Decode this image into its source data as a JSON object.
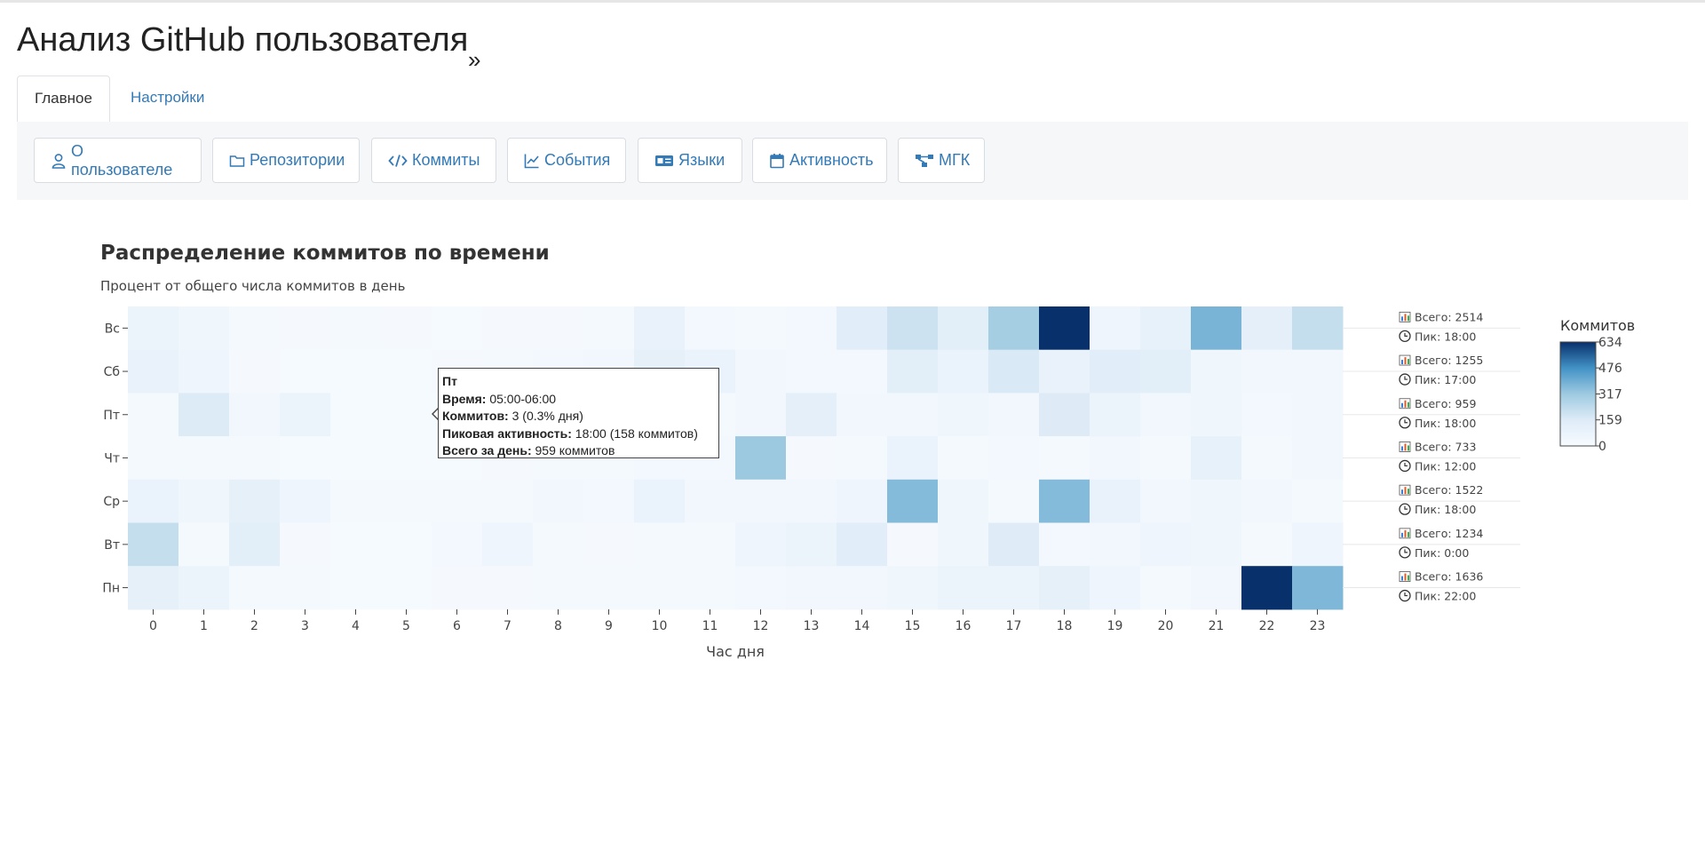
{
  "app": {
    "title": "Анализ GitHub пользователя",
    "title_glyph": "»"
  },
  "tabs": [
    {
      "label": "Главное",
      "active": true
    },
    {
      "label": "Настройки",
      "active": false
    }
  ],
  "toolbar": {
    "buttons": [
      {
        "label": "О пользователе",
        "icon": "user-icon"
      },
      {
        "label": "Репозитории",
        "icon": "folder-icon"
      },
      {
        "label": "Коммиты",
        "icon": "code-icon"
      },
      {
        "label": "События",
        "icon": "line-chart-icon"
      },
      {
        "label": "Языки",
        "icon": "id-card-icon"
      },
      {
        "label": "Активность",
        "icon": "calendar-icon"
      },
      {
        "label": "МГК",
        "icon": "network-icon"
      }
    ]
  },
  "chart_data": {
    "type": "heatmap",
    "title": "Распределение коммитов по времени",
    "subtitle": "Процент от общего числа коммитов в день",
    "xlabel": "Час дня",
    "x": [
      0,
      1,
      2,
      3,
      4,
      5,
      6,
      7,
      8,
      9,
      10,
      11,
      12,
      13,
      14,
      15,
      16,
      17,
      18,
      19,
      20,
      21,
      22,
      23
    ],
    "y": [
      "Вс",
      "Сб",
      "Пт",
      "Чт",
      "Ср",
      "Вт",
      "Пн"
    ],
    "values": [
      [
        70,
        50,
        20,
        15,
        20,
        15,
        10,
        15,
        15,
        20,
        90,
        30,
        20,
        25,
        140,
        200,
        130,
        300,
        634,
        60,
        100,
        380,
        120,
        220
      ],
      [
        90,
        60,
        15,
        10,
        10,
        10,
        15,
        20,
        30,
        40,
        110,
        80,
        40,
        30,
        25,
        130,
        80,
        170,
        90,
        140,
        130,
        50,
        40,
        40
      ],
      [
        20,
        160,
        40,
        70,
        10,
        10,
        10,
        10,
        10,
        10,
        20,
        20,
        40,
        120,
        40,
        40,
        50,
        40,
        158,
        70,
        40,
        50,
        30,
        40
      ],
      [
        20,
        20,
        20,
        10,
        10,
        10,
        10,
        15,
        20,
        20,
        25,
        25,
        320,
        15,
        20,
        80,
        20,
        30,
        20,
        40,
        20,
        100,
        20,
        40
      ],
      [
        80,
        50,
        110,
        60,
        20,
        20,
        20,
        20,
        40,
        30,
        80,
        40,
        40,
        40,
        60,
        360,
        50,
        20,
        360,
        90,
        40,
        50,
        40,
        20
      ],
      [
        220,
        20,
        130,
        15,
        10,
        10,
        30,
        60,
        20,
        15,
        20,
        20,
        60,
        70,
        140,
        15,
        50,
        150,
        30,
        40,
        60,
        50,
        20,
        60
      ],
      [
        110,
        70,
        20,
        20,
        10,
        10,
        15,
        15,
        20,
        20,
        20,
        20,
        30,
        40,
        40,
        50,
        70,
        70,
        110,
        60,
        20,
        40,
        634,
        370
      ]
    ],
    "row_totals": [
      2514,
      1255,
      959,
      733,
      1522,
      1234,
      1636
    ],
    "row_peaks": [
      "18:00",
      "17:00",
      "18:00",
      "12:00",
      "18:00",
      "0:00",
      "22:00"
    ],
    "total_label": "Всего:",
    "peak_label": "Пик:",
    "colorbar": {
      "title": "Коммитов",
      "ticks": [
        634,
        476,
        317,
        159,
        0
      ],
      "zmin": 0,
      "zmax": 634,
      "colors": [
        "#f7fbff",
        "#deebf7",
        "#9ecae1",
        "#4292c6",
        "#08306b"
      ]
    }
  },
  "tooltip": {
    "day": "Пт",
    "time_label": "Время:",
    "time_value": "05:00-06:00",
    "commits_label": "Коммитов:",
    "commits_value": "3 (0.3% дня)",
    "peak_label": "Пиковая активность:",
    "peak_value": "18:00 (158 коммитов)",
    "total_label": "Всего за день:",
    "total_value": "959 коммитов"
  }
}
